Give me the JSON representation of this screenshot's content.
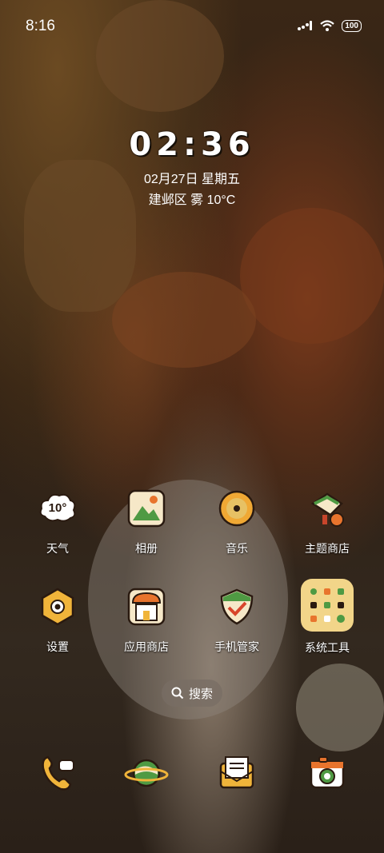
{
  "status_bar": {
    "time": "8:16",
    "battery": "100"
  },
  "clock": {
    "time": "02:36",
    "date": "02月27日 星期五",
    "weather": "建邺区 雾 10°C"
  },
  "apps_row1": [
    {
      "label": "天气",
      "icon": "weather-icon",
      "badge": "10°"
    },
    {
      "label": "相册",
      "icon": "gallery-icon"
    },
    {
      "label": "音乐",
      "icon": "music-icon"
    },
    {
      "label": "主题商店",
      "icon": "theme-store-icon"
    }
  ],
  "apps_row2": [
    {
      "label": "设置",
      "icon": "settings-icon"
    },
    {
      "label": "应用商店",
      "icon": "app-store-icon"
    },
    {
      "label": "手机管家",
      "icon": "phone-manager-icon"
    },
    {
      "label": "系统工具",
      "icon": "system-tools-folder-icon"
    }
  ],
  "search": {
    "label": "搜索"
  },
  "dock": [
    {
      "icon": "phone-icon"
    },
    {
      "icon": "browser-icon"
    },
    {
      "icon": "messages-icon"
    },
    {
      "icon": "camera-icon"
    }
  ],
  "colors": {
    "icon_bg": "#f6e8c8",
    "accent_green": "#4f9a43",
    "accent_orange": "#e8742d"
  }
}
